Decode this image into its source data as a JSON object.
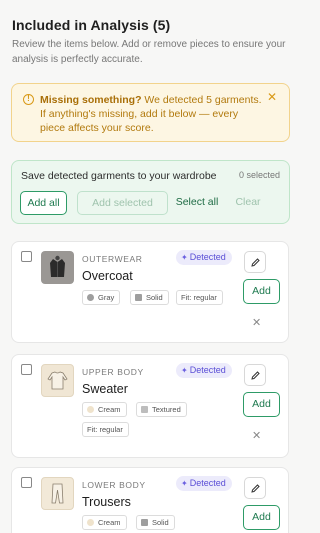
{
  "header": {
    "title": "Included in Analysis (5)",
    "subtitle": "Review the items below. Add or remove pieces to ensure your analysis is perfectly accurate."
  },
  "warning": {
    "bold": "Missing something?",
    "text": " We detected 5 garments. If anything's missing, add it below — every piece affects your score.",
    "close_label": "✕"
  },
  "wardrobe": {
    "title": "Save detected garments to your wardrobe",
    "selected_count": "0 selected",
    "add_all": "Add all",
    "add_selected": "Add selected",
    "select_all": "Select all",
    "clear": "Clear"
  },
  "items": [
    {
      "category": "OUTERWEAR",
      "name": "Overcoat",
      "badge": "Detected",
      "tags": [
        "Gray",
        "Solid",
        "Fit: regular"
      ],
      "add_label": "Add",
      "remove_label": "✕"
    },
    {
      "category": "UPPER BODY",
      "name": "Sweater",
      "badge": "Detected",
      "tags": [
        "Cream",
        "Textured",
        "Fit: regular"
      ],
      "add_label": "Add",
      "remove_label": "✕"
    },
    {
      "category": "LOWER BODY",
      "name": "Trousers",
      "badge": "Detected",
      "tags": [
        "Cream",
        "Solid"
      ],
      "add_label": "Add"
    }
  ],
  "colors": {
    "accent_green": "#2e9b67",
    "warning_amber": "#d99a18",
    "detected_purple": "#5a4ed6",
    "swatch_gray": "#9e9e9e",
    "swatch_cream": "#efe3cc"
  }
}
